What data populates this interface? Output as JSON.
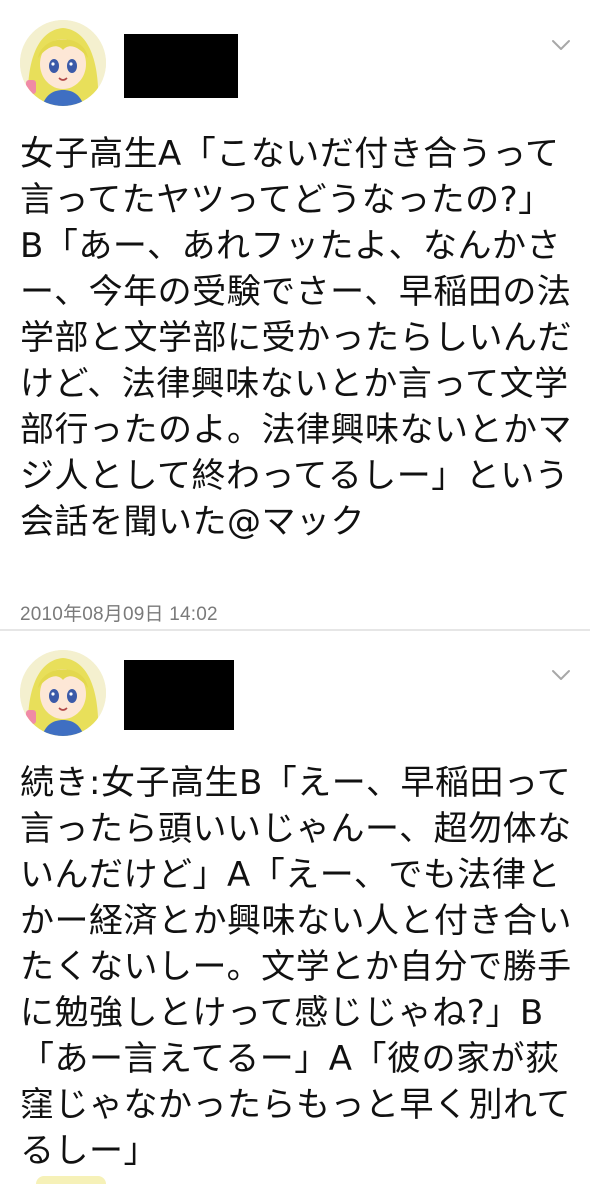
{
  "tweets": [
    {
      "text": "女子高生A「こないだ付き合うって言ってたヤツってどうなったの?」B「あー、あれフッたよ、なんかさー、今年の受験でさー、早稲田の法学部と文学部に受かったらしいんだけど、法律興味ないとか言って文学部行ったのよ。法律興味ないとかマジ人として終わってるしー」という会話を聞いた@マック",
      "timestamp": "2010年08月09日 14:02",
      "avatar_icon": "anime-girl-avatar-icon",
      "menu_icon": "chevron-down-icon"
    },
    {
      "text": "続き:女子高生B「えー、早稲田って言ったら頭いいじゃんー、超勿体ないんだけど」A「えー、でも法律とかー経済とか興味ない人と付き合いたくないしー。文学とか自分で勝手に勉強しとけって感じじゃね?」B「あー言えてるー」A「彼の家が荻窪じゃなかったらもっと早く別れてるしー」",
      "avatar_icon": "anime-girl-avatar-icon",
      "menu_icon": "chevron-down-icon"
    }
  ],
  "colors": {
    "background": "#ffffff",
    "text": "#111111",
    "timestamp": "#7a7a7a",
    "divider": "#e6e6e6",
    "redaction": "#000000"
  }
}
